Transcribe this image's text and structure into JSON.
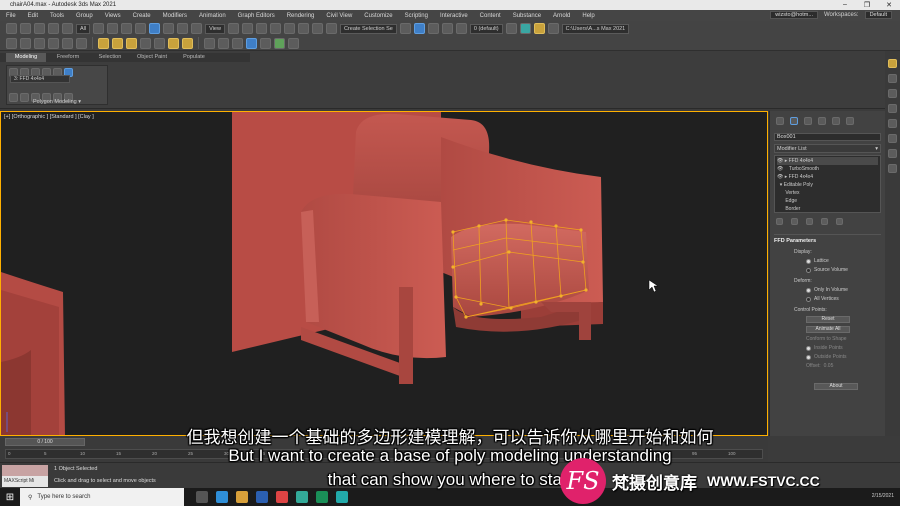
{
  "window": {
    "title": "chairA04.max - Autodesk 3ds Max 2021",
    "controls": [
      "–",
      "❐",
      "✕"
    ]
  },
  "menu": {
    "items": [
      "File",
      "Edit",
      "Tools",
      "Group",
      "Views",
      "Create",
      "Modifiers",
      "Animation",
      "Graph Editors",
      "Rendering",
      "Civil View",
      "Customize",
      "Scripting",
      "Interactive",
      "Content",
      "Substance",
      "Arnold",
      "Help"
    ],
    "user": "wizsto@hotm...",
    "workspaces_label": "Workspaces:",
    "workspaces_value": "Default"
  },
  "toolbar": {
    "filter_dropdown": "All",
    "view_dropdown": "View",
    "selection_set": "Create Selection Se",
    "layer": "0 (default)",
    "project_path": "C:\\Users\\A...s Max 2021"
  },
  "ribbon": {
    "tabs": [
      "Modeling",
      "Freeform",
      "Selection",
      "Object Paint",
      "Populate"
    ],
    "active_tab": "Modeling",
    "panel_label": "Polygon Modeling ▾",
    "modifier_tag": "3: FFD 4x4x4"
  },
  "viewport": {
    "label": "[+] [Orthographic ] [Standard ] [Clay ]"
  },
  "command_panel": {
    "object_name": "Box001",
    "modifier_list_label": "Modifier List",
    "stack": [
      "FFD 4x4x4",
      "TurboSmooth",
      "FFD 4x4x4",
      "Editable Poly",
      "Vertex",
      "Edge",
      "Border"
    ],
    "params_title": "FFD Parameters",
    "display_label": "Display:",
    "display_options": [
      "Lattice",
      "Source Volume"
    ],
    "deform_label": "Deform:",
    "deform_options": [
      "Only In Volume",
      "All Vertices"
    ],
    "control_points_label": "Control Points:",
    "reset_button": "Reset",
    "animate_all_button": "Animate All",
    "conform_button": "Conform to Shape",
    "inside_points": "Inside Points",
    "outside_points": "Outside Points",
    "offset_label": "Offset:",
    "offset_value": "0.05",
    "about_button": "About"
  },
  "timeline": {
    "frame": "0 / 100",
    "ticks": [
      "0",
      "5",
      "10",
      "15",
      "20",
      "25",
      "30",
      "35",
      "40",
      "45",
      "50",
      "55",
      "60",
      "65",
      "70",
      "75",
      "80",
      "85",
      "90",
      "95",
      "100"
    ]
  },
  "status": {
    "maxscript_label": "MAXScript Mi",
    "line1": "1 Object Selected",
    "line2": "Click and drag to select and move objects"
  },
  "taskbar": {
    "search_placeholder": "Type here to search",
    "clock": "2/15/2021"
  },
  "subtitles": {
    "chinese": "但我想创建一个基础的多边形建模理解，可以告诉你从哪里开始和如何",
    "english_line1": "But I want to create a base of poly modeling understanding",
    "english_line2": "that can show you where to start"
  },
  "watermark": {
    "logo_text": "FS",
    "brand_cn": "梵摄创意库",
    "url": "WWW.FSTVC.CC"
  },
  "colors": {
    "chair": "#c0524a",
    "lattice": "#f0a020",
    "selection_border": "#ffb000",
    "accent": "#3f7fc7"
  }
}
